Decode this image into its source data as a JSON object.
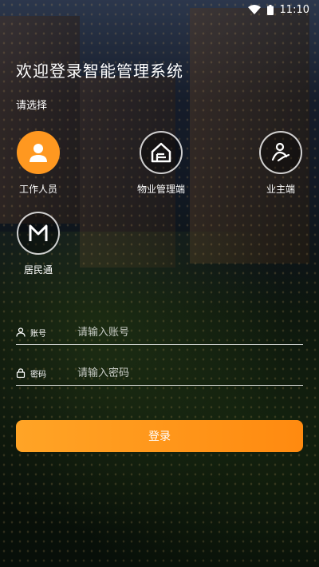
{
  "status_bar": {
    "time": "11:10"
  },
  "title": "欢迎登录智能管理系统",
  "subtitle": "请选择",
  "roles": [
    {
      "label": "工作人员",
      "icon": "person-icon",
      "active": true
    },
    {
      "label": "物业管理端",
      "icon": "property-house-icon",
      "active": false
    },
    {
      "label": "业主端",
      "icon": "owner-handshake-icon",
      "active": false
    },
    {
      "label": "居民通",
      "icon": "resident-m-icon",
      "active": false
    }
  ],
  "form": {
    "account_label": "账号",
    "account_placeholder": "请输入账号",
    "password_label": "密码",
    "password_placeholder": "请输入密码"
  },
  "login_button": "登录",
  "colors": {
    "accent": "#ff9820",
    "button_start": "#ffa426",
    "button_end": "#ff8a10"
  }
}
